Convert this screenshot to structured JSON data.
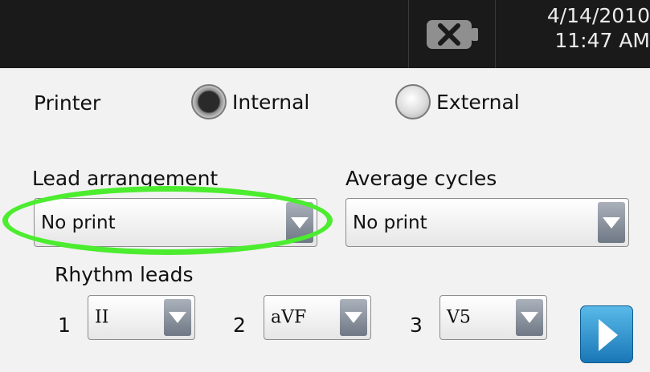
{
  "status_bar": {
    "battery_icon": "battery-empty-icon",
    "date": "4/14/2010",
    "time": "11:47 AM"
  },
  "printer": {
    "label": "Printer",
    "options": [
      {
        "label": "Internal",
        "selected": true
      },
      {
        "label": "External",
        "selected": false
      }
    ]
  },
  "lead_arrangement": {
    "label": "Lead arrangement",
    "value": "No print"
  },
  "average_cycles": {
    "label": "Average cycles",
    "value": "No print"
  },
  "rhythm_leads": {
    "label": "Rhythm leads",
    "items": [
      {
        "number": "1",
        "value": "II"
      },
      {
        "number": "2",
        "value": "aVF"
      },
      {
        "number": "3",
        "value": "V5"
      }
    ]
  },
  "next_button": {
    "icon": "chevron-right-icon"
  },
  "colors": {
    "highlight_ring": "#4cec2f",
    "next_button": "#1a77b7",
    "top_bar": "#1a1a1a"
  }
}
